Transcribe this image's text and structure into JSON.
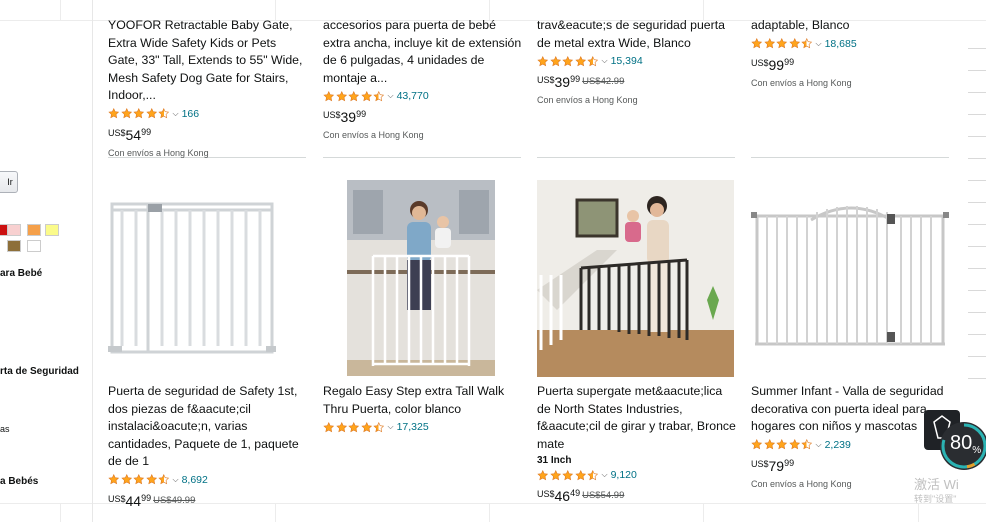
{
  "sidebar": {
    "go_label": "Ir",
    "swatch_colors": [
      "#cc1111",
      "#f8d0d0",
      "#f5a04a",
      "#fbfb8a",
      "#8d6f3a",
      "#8a7a5a",
      "#ffffff"
    ],
    "labels": [
      "ara Bebé",
      "rta de Seguridad",
      "as",
      "a Bebés"
    ]
  },
  "products": [
    {
      "title": "YOOFOR Retractable Baby Gate, Extra Wide Safety Kids or Pets Gate, 33\" Tall, Extends to 55\" Wide, Mesh Safety Dog Gate for Stairs, Indoor,...",
      "rating": 4.5,
      "rating_count": "166",
      "currency": "US$",
      "price_int": "54",
      "price_cents": "99",
      "shipping": "Con envíos a Hong Kong"
    },
    {
      "title": "accesorios para puerta de bebé extra ancha, incluye kit de extensión de 6 pulgadas, 4 unidades de montaje a...",
      "rating": 4.5,
      "rating_count": "43,770",
      "currency": "US$",
      "price_int": "39",
      "price_cents": "99",
      "shipping": "Con envíos a Hong Kong"
    },
    {
      "title": "trav&eacute;s de seguridad puerta de metal extra Wide, Blanco",
      "rating": 4.5,
      "rating_count": "15,394",
      "currency": "US$",
      "price_int": "39",
      "price_cents": "99",
      "old_price": "US$42.99",
      "shipping": "Con envíos a Hong Kong"
    },
    {
      "title": "adaptable, Blanco",
      "rating": 4.5,
      "rating_count": "18,685",
      "currency": "US$",
      "price_int": "99",
      "price_cents": "99",
      "shipping": "Con envíos a Hong Kong"
    },
    {
      "title": "Puerta de seguridad de Safety 1st, dos piezas de f&aacute;cil instalaci&oacute;n, varias cantidades, Paquete de 1, paquete de de 1",
      "rating": 4.5,
      "rating_count": "8,692",
      "currency": "US$",
      "price_int": "44",
      "price_cents": "99",
      "old_price": "US$49.99"
    },
    {
      "title": "Regalo Easy Step extra Tall Walk Thru Puerta, color blanco",
      "rating": 4.5,
      "rating_count": "17,325"
    },
    {
      "title": "Puerta supergate met&aacute;lica de North States Industries, f&aacute;cil de girar y trabar, Bronce mate",
      "size": "31 Inch",
      "rating": 4.5,
      "rating_count": "9,120",
      "currency": "US$",
      "price_int": "46",
      "price_cents": "49",
      "old_price": "US$54.99"
    },
    {
      "title": "Summer Infant - Valla de seguridad decorativa con puerta ideal para hogares con niños y mascotas",
      "rating": 4.5,
      "rating_count": "2,239",
      "currency": "US$",
      "price_int": "79",
      "price_cents": "99",
      "shipping": "Con envíos a Hong Kong"
    }
  ],
  "overlay": {
    "percent": "80",
    "percent_sign": "%",
    "watermark_line1": "激活 Wi",
    "watermark_line2": "转到\"设置\""
  },
  "colors": {
    "star": "#ffa41c",
    "link": "#007185",
    "accent_teal": "#2bb3b3"
  }
}
